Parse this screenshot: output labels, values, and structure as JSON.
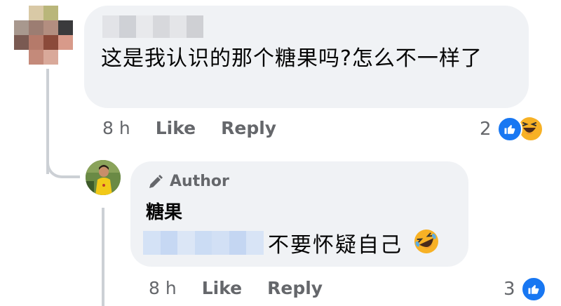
{
  "comment": {
    "text": "这是我认识的那个糖果吗?怎么不一样了",
    "time": "8 h",
    "like_label": "Like",
    "reply_label": "Reply",
    "reaction_count": "2",
    "reactions": [
      "like-icon",
      "haha-icon"
    ]
  },
  "reply": {
    "badge": "Author",
    "author_name": "糖果",
    "text": "不要怀疑自己",
    "emoji": "rofl-emoji",
    "time": "8 h",
    "like_label": "Like",
    "reply_label": "Reply",
    "reaction_count": "3",
    "reactions": [
      "like-icon"
    ]
  },
  "colors": {
    "bubble": "#f0f2f5",
    "meta_text": "#65676b",
    "like_blue": "#1877f2",
    "haha_yellow": "#f7b125",
    "thread_line": "#ccd0d5"
  }
}
